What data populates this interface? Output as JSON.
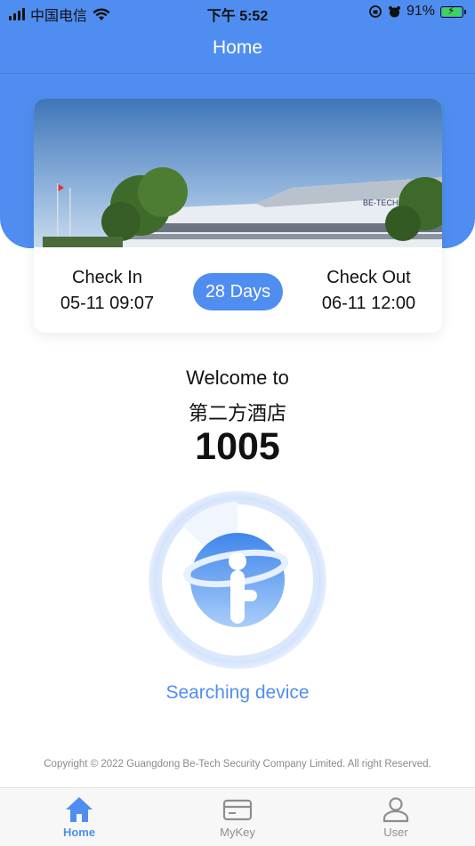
{
  "status_bar": {
    "carrier": "中国电信",
    "time": "下午 5:52",
    "battery": "91%"
  },
  "header": {
    "title": "Home"
  },
  "stay": {
    "check_in_label": "Check In",
    "check_in_value": "05-11 09:07",
    "duration": "28 Days",
    "check_out_label": "Check Out",
    "check_out_value": "06-11 12:00"
  },
  "welcome": {
    "greeting": "Welcome to",
    "hotel_name": "第二方酒店",
    "room_number": "1005"
  },
  "device": {
    "status": "Searching device"
  },
  "footer": {
    "copyright": "Copyright © 2022 Guangdong Be-Tech Security Company Limited. All right Reserved."
  },
  "tab_bar": {
    "tabs": [
      {
        "label": "Home",
        "icon": "home-icon",
        "active": true
      },
      {
        "label": "MyKey",
        "icon": "card-icon",
        "active": false
      },
      {
        "label": "User",
        "icon": "user-icon",
        "active": false
      }
    ]
  },
  "colors": {
    "accent": "#4f8ef0",
    "text": "#111111",
    "muted": "#8a8a8a"
  }
}
